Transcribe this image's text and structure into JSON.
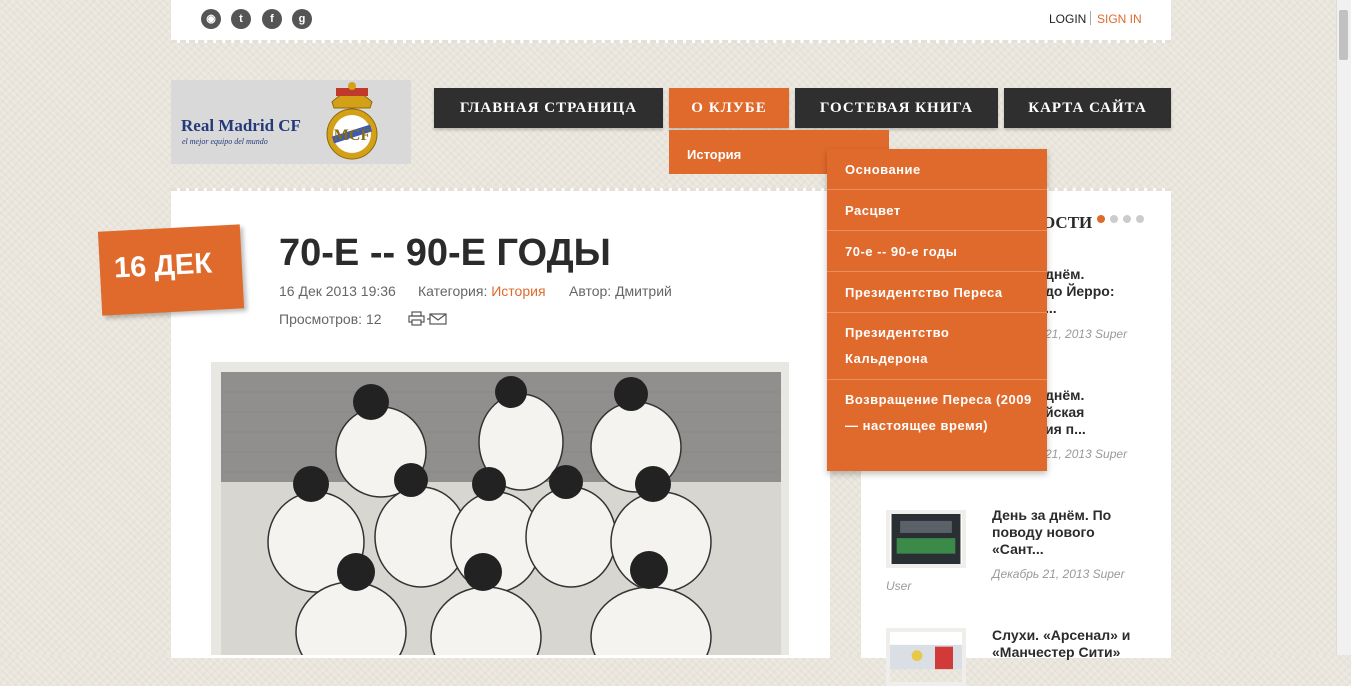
{
  "topbar": {
    "social": [
      {
        "icon": "rss-icon",
        "glyph": "◉"
      },
      {
        "icon": "twitter-icon",
        "glyph": "t"
      },
      {
        "icon": "facebook-icon",
        "glyph": "f"
      },
      {
        "icon": "google-icon",
        "glyph": "g"
      }
    ],
    "login": "LOGIN",
    "signin": "SIGN IN"
  },
  "logo": {
    "title": "Real Madrid CF",
    "tagline": "el mejor equipo del mundo"
  },
  "nav": [
    {
      "label": "ГЛАВНАЯ СТРАНИЦА"
    },
    {
      "label": "О КЛУБЕ"
    },
    {
      "label": "ГОСТЕВАЯ КНИГА"
    },
    {
      "label": "КАРТА САЙТА"
    }
  ],
  "dropdown": {
    "level1": "История",
    "level2": [
      "Основание",
      "Расцвет",
      "70-е -- 90-е годы",
      "Президентство Переса",
      "Президентство Кальдерона",
      "Возвращение Переса (2009 — настоящее время)"
    ]
  },
  "article": {
    "date_badge": "16 ДЕК",
    "title": "70-Е -- 90-Е ГОДЫ",
    "datetime": "16 Дек 2013 19:36",
    "category_label": "Категория:",
    "category": "История",
    "author_label": "Автор:",
    "author": "Дмитрий",
    "views_label": "Просмотров:",
    "views": "12"
  },
  "sidebar": {
    "heading": "ОСТИ",
    "items": [
      {
        "title_lines": [
          "днём.",
          "до Йерро:",
          "..."
        ],
        "date": "21, 2013 Super"
      },
      {
        "title_lines": [
          "днём.",
          "йская",
          "ия п..."
        ],
        "date": "21, 2013 Super"
      },
      {
        "title_lines": [
          "День за днём. По",
          "поводу нового",
          "«Сант..."
        ],
        "date": "Декабрь 21, 2013 Super",
        "author": "User"
      },
      {
        "title_lines": [
          "Слухи. «Арсенал» и",
          "«Манчестер Сити»"
        ],
        "date": ""
      }
    ]
  },
  "colors": {
    "accent": "#e06a2c",
    "dark": "#2f2f2f"
  }
}
